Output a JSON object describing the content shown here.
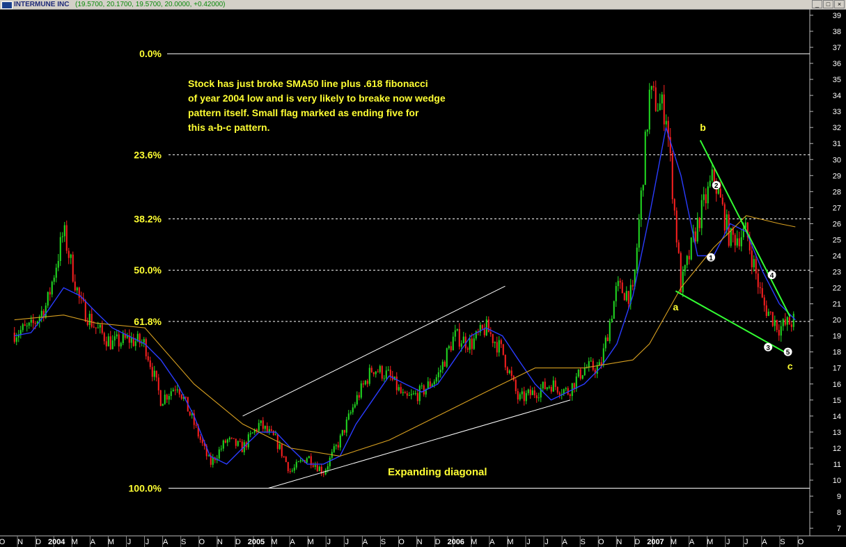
{
  "window": {
    "title": "INTERMUNE INC",
    "ohlc": "(19.5700, 20.1700, 19.5700, 20.0000, +0.42000)",
    "buttons": [
      "minimize-button",
      "maximize-button",
      "close-button"
    ]
  },
  "chart_data": {
    "type": "candlestick",
    "title": "INTERMUNE INC",
    "ylim": [
      6.5,
      39.5
    ],
    "y_ticks": [
      7,
      8,
      9,
      10,
      11,
      12,
      13,
      14,
      15,
      16,
      17,
      18,
      19,
      20,
      21,
      22,
      23,
      24,
      25,
      26,
      27,
      28,
      29,
      30,
      31,
      32,
      33,
      34,
      35,
      36,
      37,
      38,
      39
    ],
    "x_labels": [
      "O",
      "N",
      "D",
      "2004",
      "M",
      "A",
      "M",
      "J",
      "J",
      "A",
      "S",
      "O",
      "N",
      "D",
      "2005",
      "M",
      "A",
      "M",
      "J",
      "J",
      "A",
      "S",
      "O",
      "N",
      "D",
      "2006",
      "M",
      "A",
      "M",
      "J",
      "J",
      "A",
      "S",
      "O",
      "N",
      "D",
      "2007",
      "M",
      "A",
      "M",
      "J",
      "J",
      "A",
      "S",
      "O"
    ],
    "x_label_range": [
      "2003-10",
      "2007-10"
    ],
    "colors": {
      "up_candle": "#22dd22",
      "down_candle": "#ff2020",
      "sma50": "#2a3cff",
      "sma200": "#d8a020",
      "trendline": "#ffffff",
      "wedge": "#33ff33",
      "fibonacci": "#ffffff",
      "text": "#ffff33"
    },
    "price_path": [
      [
        "2003-10",
        19.2
      ],
      [
        "2003-11",
        19.5
      ],
      [
        "2003-12",
        21.0
      ],
      [
        "2004-01",
        25.5
      ],
      [
        "2004-02",
        21.0
      ],
      [
        "2004-03",
        19.5
      ],
      [
        "2004-04",
        18.5
      ],
      [
        "2004-05",
        18.8
      ],
      [
        "2004-06",
        18.5
      ],
      [
        "2004-07",
        15.0
      ],
      [
        "2004-08",
        16.0
      ],
      [
        "2004-09",
        13.5
      ],
      [
        "2004-10",
        11.0
      ],
      [
        "2004-11",
        12.5
      ],
      [
        "2004-12",
        12.0
      ],
      [
        "2005-01",
        13.5
      ],
      [
        "2005-02",
        12.5
      ],
      [
        "2005-03",
        10.5
      ],
      [
        "2005-04",
        11.5
      ],
      [
        "2005-05",
        10.5
      ],
      [
        "2005-06",
        12.5
      ],
      [
        "2005-07",
        15.0
      ],
      [
        "2005-08",
        17.0
      ],
      [
        "2005-09",
        16.5
      ],
      [
        "2005-10",
        15.0
      ],
      [
        "2005-11",
        15.5
      ],
      [
        "2005-12",
        16.5
      ],
      [
        "2006-01",
        19.0
      ],
      [
        "2006-02",
        18.5
      ],
      [
        "2006-03",
        19.5
      ],
      [
        "2006-04",
        18.0
      ],
      [
        "2006-05",
        15.0
      ],
      [
        "2006-06",
        15.5
      ],
      [
        "2006-07",
        16.0
      ],
      [
        "2006-08",
        15.5
      ],
      [
        "2006-09",
        17.0
      ],
      [
        "2006-10",
        17.0
      ],
      [
        "2006-11",
        22.0
      ],
      [
        "2006-12",
        21.5
      ],
      [
        "2007-01",
        34.0
      ],
      [
        "2007-02",
        33.0
      ],
      [
        "2007-03",
        22.0
      ],
      [
        "2007-04",
        26.0
      ],
      [
        "2007-05",
        29.0
      ],
      [
        "2007-06",
        25.0
      ],
      [
        "2007-07",
        25.5
      ],
      [
        "2007-08",
        21.0
      ],
      [
        "2007-09",
        19.5
      ],
      [
        "2007-10",
        20.0
      ]
    ],
    "series": [
      {
        "name": "SMA50",
        "x": [
          "2003-10",
          "2003-11",
          "2003-12",
          "2004-01",
          "2004-02",
          "2004-03",
          "2004-04",
          "2004-05",
          "2004-06",
          "2004-07",
          "2004-08",
          "2004-09",
          "2004-10",
          "2004-11",
          "2004-12",
          "2005-01",
          "2005-02",
          "2005-03",
          "2005-04",
          "2005-05",
          "2005-06",
          "2005-07",
          "2005-08",
          "2005-09",
          "2005-10",
          "2005-11",
          "2005-12",
          "2006-01",
          "2006-02",
          "2006-03",
          "2006-04",
          "2006-05",
          "2006-06",
          "2006-07",
          "2006-08",
          "2006-09",
          "2006-10",
          "2006-11",
          "2006-12",
          "2007-01",
          "2007-02",
          "2007-03",
          "2007-04",
          "2007-05",
          "2007-06",
          "2007-07",
          "2007-08",
          "2007-09",
          "2007-10"
        ],
        "values": [
          19.0,
          19.2,
          20.5,
          22.0,
          21.5,
          20.5,
          19.5,
          19.0,
          18.5,
          17.5,
          16.0,
          14.0,
          11.5,
          11.0,
          12.0,
          13.0,
          13.0,
          12.0,
          11.0,
          11.0,
          11.5,
          13.5,
          15.0,
          16.5,
          16.0,
          15.5,
          16.0,
          17.5,
          19.0,
          19.5,
          19.0,
          17.5,
          16.0,
          15.0,
          15.5,
          16.0,
          17.0,
          18.5,
          21.5,
          26.5,
          32.0,
          29.0,
          24.0,
          24.0,
          26.0,
          25.5,
          23.0,
          21.0,
          20.0
        ]
      },
      {
        "name": "SMA200",
        "x": [
          "2003-10",
          "2004-01",
          "2004-03",
          "2004-06",
          "2004-09",
          "2004-12",
          "2005-03",
          "2005-06",
          "2005-09",
          "2005-12",
          "2006-03",
          "2006-06",
          "2006-09",
          "2006-12",
          "2007-01",
          "2007-03",
          "2007-05",
          "2007-07",
          "2007-09",
          "2007-10"
        ],
        "values": [
          20.0,
          20.3,
          19.8,
          19.5,
          16.0,
          13.5,
          12.0,
          11.5,
          12.5,
          14.0,
          15.5,
          17.0,
          17.0,
          17.5,
          18.5,
          22.0,
          24.5,
          26.5,
          26.0,
          25.8
        ]
      }
    ],
    "fibonacci_levels": [
      {
        "label": "0.0%",
        "value": 36.6
      },
      {
        "label": "23.6%",
        "value": 30.3
      },
      {
        "label": "38.2%",
        "value": 26.3
      },
      {
        "label": "50.0%",
        "value": 23.1
      },
      {
        "label": "61.8%",
        "value": 19.9
      },
      {
        "label": "100.0%",
        "value": 9.5
      }
    ],
    "trendlines": [
      {
        "name": "diagonal-upper",
        "from": [
          "2004-12-15",
          14.0
        ],
        "to": [
          "2006-04-20",
          22.1
        ],
        "color": "white"
      },
      {
        "name": "diagonal-lower",
        "from": [
          "2005-02-01",
          9.5
        ],
        "to": [
          "2006-08-20",
          15.0
        ],
        "color": "white"
      },
      {
        "name": "wedge-upper",
        "from": [
          "2007-04-20",
          31.2
        ],
        "to": [
          "2007-10-05",
          20.2
        ],
        "color": "green"
      },
      {
        "name": "wedge-lower",
        "from": [
          "2007-03-05",
          21.8
        ],
        "to": [
          "2007-10-05",
          17.8
        ],
        "color": "green"
      }
    ],
    "wave_labels": [
      {
        "text": "a",
        "x": "2007-03-05",
        "y": 20.6,
        "style": "letter"
      },
      {
        "text": "b",
        "x": "2007-04-25",
        "y": 31.8,
        "style": "letter"
      },
      {
        "text": "c",
        "x": "2007-10-05",
        "y": 16.9,
        "style": "letter"
      },
      {
        "text": "1",
        "x": "2007-05-10",
        "y": 23.9,
        "style": "circle"
      },
      {
        "text": "2",
        "x": "2007-05-20",
        "y": 28.4,
        "style": "circle"
      },
      {
        "text": "3",
        "x": "2007-08-25",
        "y": 18.3,
        "style": "circle"
      },
      {
        "text": "4",
        "x": "2007-09-01",
        "y": 22.8,
        "style": "circle"
      },
      {
        "text": "5",
        "x": "2007-10-01",
        "y": 18.0,
        "style": "circle"
      }
    ],
    "annotations": {
      "commentary": "Stock has just broke SMA50 line plus .618 fibonacci\nof year 2004 low and is very likely to breake now wedge\npattern itself. Small flag marked as ending five for\nthis a-b-c pattern.",
      "pattern_label": "Expanding diagonal"
    }
  }
}
